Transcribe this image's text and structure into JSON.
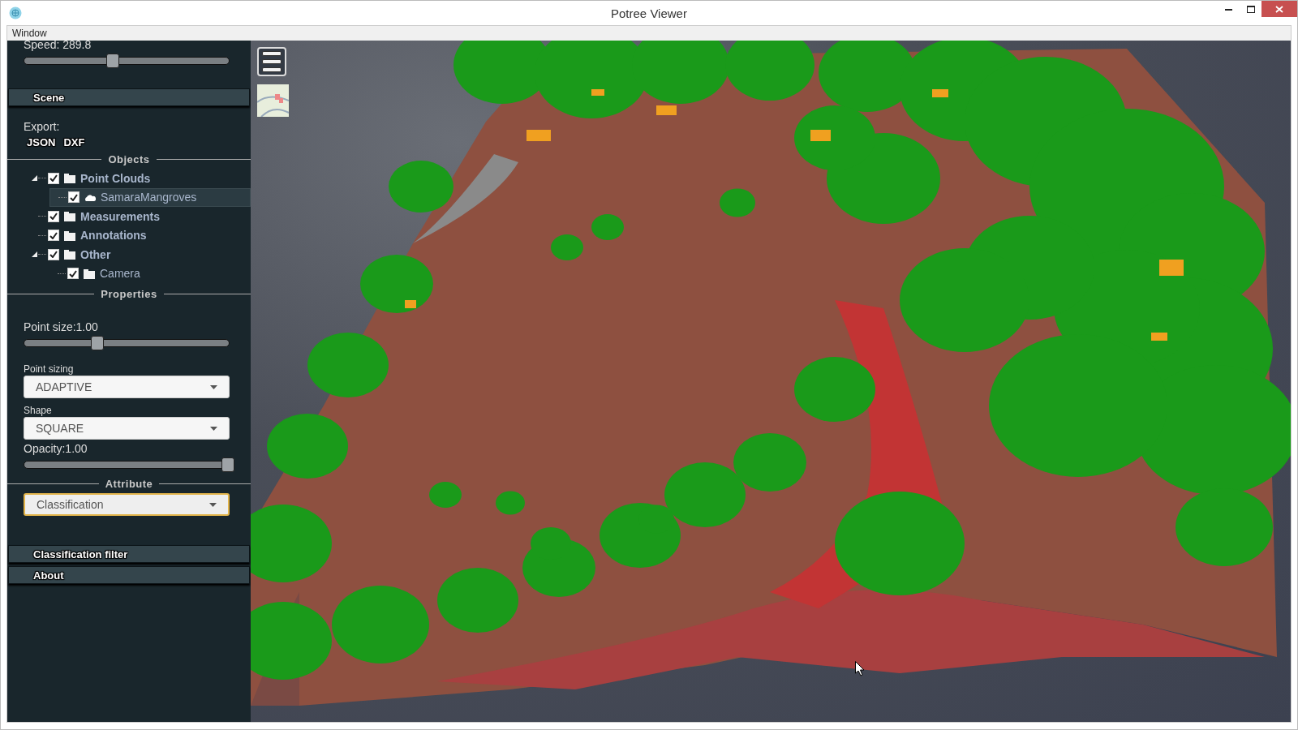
{
  "window": {
    "title": "Potree Viewer"
  },
  "menu_bar": [
    "Window"
  ],
  "sidebar": {
    "speed": {
      "label": "Speed: 289.8",
      "level": 0.42
    },
    "scene": {
      "title": "Scene",
      "export_label": "Export:",
      "export_buttons": [
        "JSON",
        "DXF"
      ],
      "objects_heading": "Objects",
      "tree": [
        {
          "label": "Point Clouds",
          "kind": "folder",
          "checked": true,
          "selected": false,
          "expanded": true,
          "children": [
            {
              "label": "SamaraMangroves",
              "kind": "cloud",
              "checked": true,
              "selected": true
            }
          ]
        },
        {
          "label": "Measurements",
          "kind": "folder",
          "checked": true,
          "selected": false
        },
        {
          "label": "Annotations",
          "kind": "folder",
          "checked": true,
          "selected": false
        },
        {
          "label": "Other",
          "kind": "folder",
          "checked": true,
          "selected": false,
          "expanded": true,
          "children": [
            {
              "label": "Camera",
              "kind": "folder",
              "checked": true,
              "selected": false
            }
          ]
        }
      ],
      "properties_heading": "Properties",
      "point_size": {
        "label": "Point size:1.00",
        "level": 0.34
      },
      "point_sizing": {
        "label": "Point sizing",
        "value": "ADAPTIVE"
      },
      "shape": {
        "label": "Shape",
        "value": "SQUARE"
      },
      "opacity": {
        "label": "Opacity:1.00",
        "level": 1.0
      },
      "attribute_heading": "Attribute",
      "attribute": {
        "value": "Classification",
        "focused": true
      }
    },
    "panels": [
      "Classification filter",
      "About"
    ]
  }
}
